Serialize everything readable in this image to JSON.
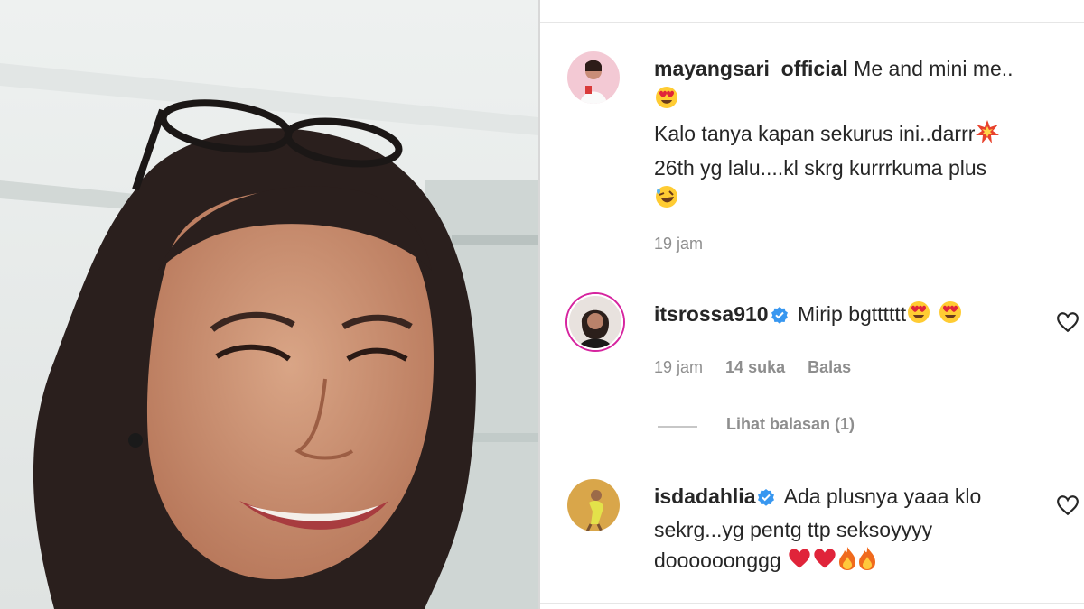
{
  "post_caption": {
    "username": "mayangsari_official",
    "line1": "Me and mini me..",
    "line2": "Kalo tanya kapan sekurus ini..darrr",
    "line3": "26th yg lalu....kl skrg kurrrkuma plus",
    "time": "19 jam"
  },
  "comments": [
    {
      "username": "itsrossa910",
      "text": "Mirip bgtttttt",
      "time": "19 jam",
      "likes": "14 suka",
      "reply": "Balas",
      "view_replies": "Lihat balasan (1)"
    },
    {
      "username": "isdadahlia",
      "line1": "Ada plusnya yaaa klo",
      "line2": "sekrg...yg pentg ttp seksoyyyy",
      "line3": "doooooonggg"
    }
  ],
  "icons": [
    "verified-badge-icon",
    "heart-outline-icon",
    "heart-eyes-emoji",
    "collision-emoji",
    "rofl-emoji",
    "red-heart-emoji",
    "fire-emoji"
  ],
  "colors": {
    "verified": "#3897f0",
    "muted": "#8e8e8e",
    "text": "#262626"
  }
}
